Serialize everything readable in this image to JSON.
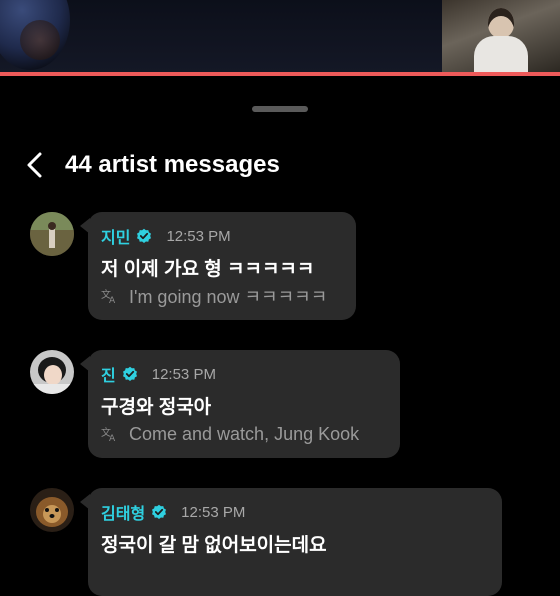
{
  "header": {
    "title": "44 artist messages"
  },
  "messages": [
    {
      "name": "지민",
      "time": "12:53 PM",
      "text": "저 이제 가요 형 ㅋㅋㅋㅋㅋ",
      "translation": "I'm going now ㅋㅋㅋㅋㅋ"
    },
    {
      "name": "진",
      "time": "12:53 PM",
      "text": "구경와 정국아",
      "translation": "Come and watch, Jung Kook"
    },
    {
      "name": "김태형",
      "time": "12:53 PM",
      "text": "정국이 갈 맘 없어보이는데요",
      "translation": ""
    }
  ],
  "colors": {
    "accent_name": "#2fd0e0",
    "progress": "#ee5a5a",
    "bubble": "#2b2b2b"
  },
  "icons": {
    "back": "chevron-left-icon",
    "verified": "verified-badge-icon",
    "translate": "translate-icon"
  }
}
